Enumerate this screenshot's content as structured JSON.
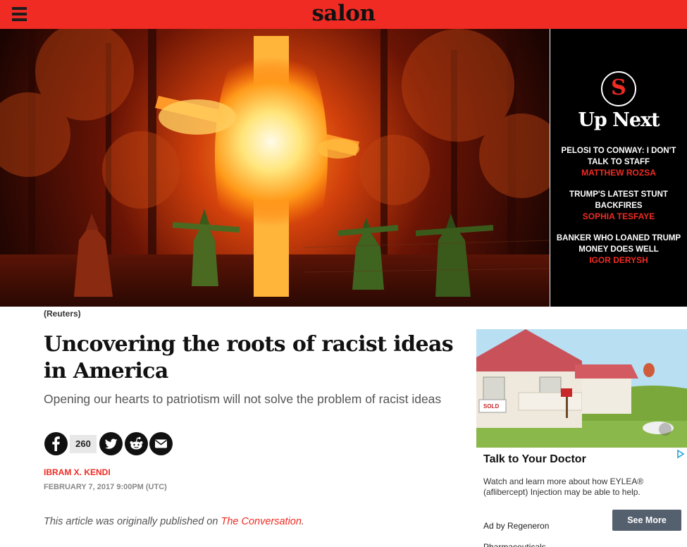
{
  "header": {
    "logo": "salon",
    "menu_icon": "hamburger-menu-icon",
    "bg_color": "#ef2b23"
  },
  "hero": {
    "caption": "(Reuters)"
  },
  "up_next": {
    "badge_letter": "S",
    "title": "Up Next",
    "items": [
      {
        "headline": "PELOSI TO CONWAY: I DON'T TALK TO STAFF",
        "author": "MATTHEW ROZSA"
      },
      {
        "headline": "TRUMP'S LATEST STUNT BACKFIRES",
        "author": "SOPHIA TESFAYE"
      },
      {
        "headline": "BANKER WHO LOANED TRUMP MONEY DOES WELL",
        "author": "IGOR DERYSH"
      }
    ]
  },
  "article": {
    "headline": "Uncovering the roots of racist ideas in America",
    "dek": "Opening our hearts to patriotism will not solve the problem of racist ideas",
    "share_count": "260",
    "share_icons": [
      "facebook-icon",
      "twitter-icon",
      "reddit-icon",
      "email-icon"
    ],
    "author": "IBRAM X. KENDI",
    "date": "FEBRUARY 7, 2017 9:00PM (UTC)",
    "original_prefix": "This article was originally published on ",
    "original_link": "The Conversation",
    "original_suffix": "."
  },
  "ad": {
    "sign_text": "SOLD",
    "title": "Talk to Your Doctor",
    "body": "Watch and learn more about how EYLEA® (aflibercept) Injection may be able to help.",
    "sponsor_line1": "Ad by Regeneron",
    "sponsor_line2": "Pharmaceuticals",
    "cta": "See More"
  }
}
